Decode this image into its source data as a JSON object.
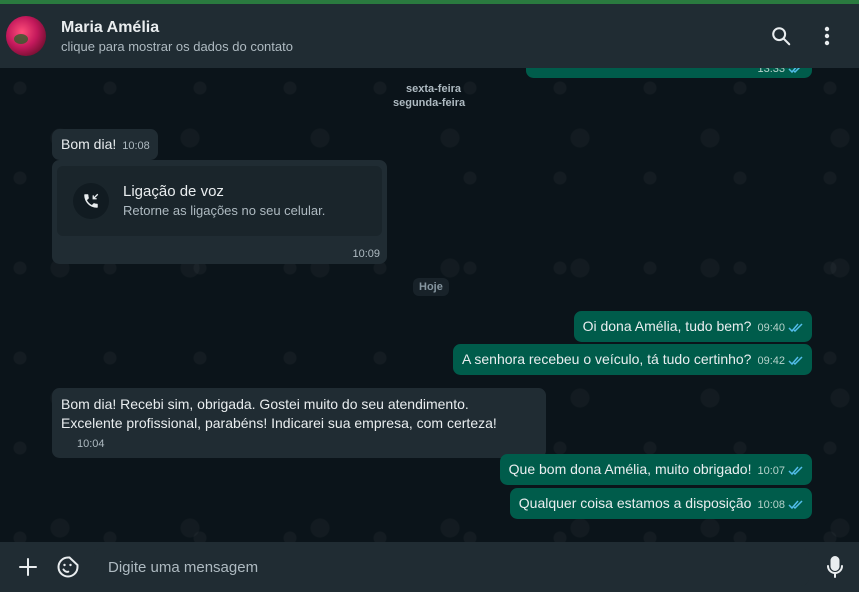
{
  "header": {
    "contact_name": "Maria Amélia",
    "contact_subtitle": "clique para mostrar os dados do contato",
    "icons": [
      "search-icon",
      "menu-dots-icon"
    ]
  },
  "dates": {
    "sexta": "sexta-feira",
    "segunda": "segunda-feira",
    "hoje": "Hoje"
  },
  "messages": {
    "top_partial_time": "13:33",
    "m1_text": "Bom dia!",
    "m1_time": "10:08",
    "call_title": "Ligação de voz",
    "call_sub": "Retorne as ligações no seu celular.",
    "call_time": "10:09",
    "m3_text": "Oi dona Amélia, tudo bem?",
    "m3_time": "09:40",
    "m4_text": "A senhora recebeu o veículo, tá tudo certinho?",
    "m4_time": "09:42",
    "m5_line1": "Bom dia! Recebi sim, obrigada.  Gostei muito do seu atendimento.",
    "m5_line2": "Excelente profissional,  parabéns! Indicarei sua empresa, com certeza!",
    "m5_time": "10:04",
    "m6_text": "Que bom dona Amélia, muito obrigado!",
    "m6_time": "10:07",
    "m7_text": "Qualquer coisa estamos a disposição",
    "m7_time": "10:08"
  },
  "composer": {
    "placeholder": "Digite uma mensagem",
    "icons": [
      "plus-icon",
      "sticker-icon",
      "microphone-icon"
    ]
  },
  "colors": {
    "header_bg": "#202c33",
    "incoming_bg": "#202c33",
    "outgoing_bg": "#005c4b",
    "tick_blue": "#53bdeb",
    "chat_bg": "#0b141a"
  }
}
